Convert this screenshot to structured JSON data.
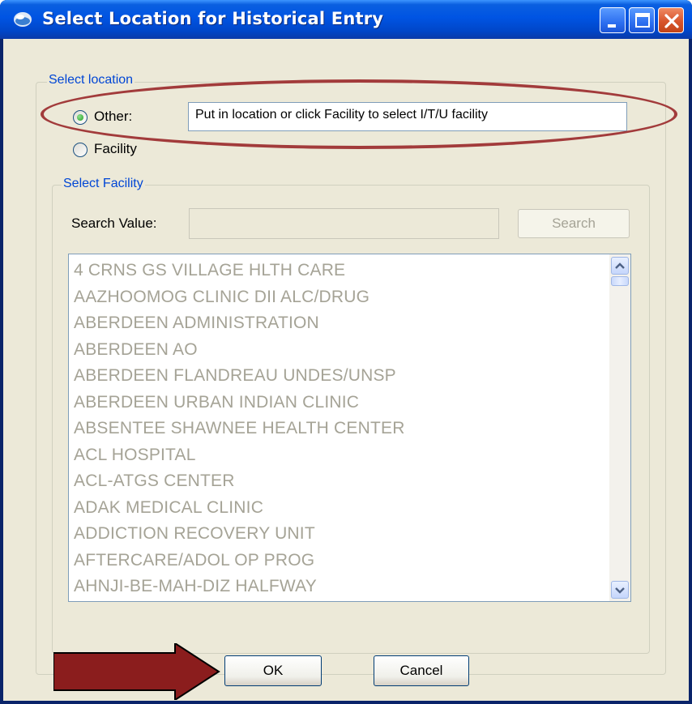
{
  "window": {
    "title": "Select Location for Historical Entry",
    "buttons": {
      "minimize_icon": "minimize-icon",
      "maximize_icon": "maximize-icon",
      "close_icon": "close-icon"
    }
  },
  "select_location": {
    "group_label": "Select location",
    "other_label": "Other:",
    "other_selected": true,
    "other_value": "Put in location or click Facility to select I/T/U facility",
    "facility_label": "Facility",
    "facility_selected": false
  },
  "select_facility": {
    "group_label": "Select Facility",
    "search_label": "Search Value:",
    "search_value": "",
    "search_button": "Search",
    "items": [
      "4 CRNS GS VILLAGE HLTH CARE",
      "AAZHOOMOG CLINIC DII ALC/DRUG",
      "ABERDEEN ADMINISTRATION",
      "ABERDEEN AO",
      "ABERDEEN FLANDREAU UNDES/UNSP",
      "ABERDEEN URBAN INDIAN CLINIC",
      "ABSENTEE SHAWNEE HEALTH CENTER",
      "ACL HOSPITAL",
      "ACL-ATGS CENTER",
      "ADAK MEDICAL CLINIC",
      "ADDICTION RECOVERY UNIT",
      "AFTERCARE/ADOL OP PROG",
      "AHNJI-BE-MAH-DIZ HALFWAY"
    ]
  },
  "footer": {
    "ok_label": "OK",
    "cancel_label": "Cancel"
  },
  "annotation": {
    "color": "#a23b3b"
  }
}
